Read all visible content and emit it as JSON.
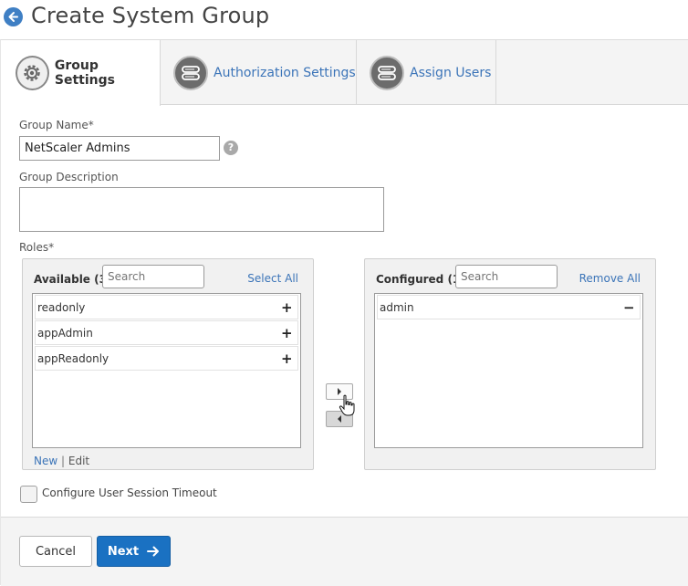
{
  "header": {
    "title": "Create System Group",
    "back_icon": "arrow-left-icon"
  },
  "tabs": [
    {
      "label": "Group Settings",
      "icon": "gear-icon",
      "active": true
    },
    {
      "label": "Authorization Settings",
      "icon": "server-stack-icon",
      "active": false
    },
    {
      "label": "Assign Users",
      "icon": "server-stack-icon",
      "active": false
    }
  ],
  "form": {
    "group_name_label": "Group Name*",
    "group_name_value": "NetScaler Admins",
    "help_glyph": "?",
    "group_description_label": "Group Description",
    "group_description_value": "",
    "roles_label": "Roles*"
  },
  "available": {
    "title": "Available (3)",
    "search_placeholder": "Search",
    "action_label": "Select All",
    "items": [
      {
        "label": "readonly",
        "action": "+"
      },
      {
        "label": "appAdmin",
        "action": "+"
      },
      {
        "label": "appReadonly",
        "action": "+"
      }
    ],
    "footer_new": "New",
    "footer_sep": "|",
    "footer_edit": "Edit"
  },
  "configured": {
    "title": "Configured (1)",
    "search_placeholder": "Search",
    "action_label": "Remove All",
    "items": [
      {
        "label": "admin",
        "action": "−"
      }
    ]
  },
  "session_timeout": {
    "label": "Configure User Session Timeout",
    "checked": false
  },
  "footer": {
    "cancel_label": "Cancel",
    "next_label": "Next"
  },
  "colors": {
    "accent": "#1a71c2",
    "link": "#3b74b8",
    "back_button": "#3f7fc4"
  }
}
